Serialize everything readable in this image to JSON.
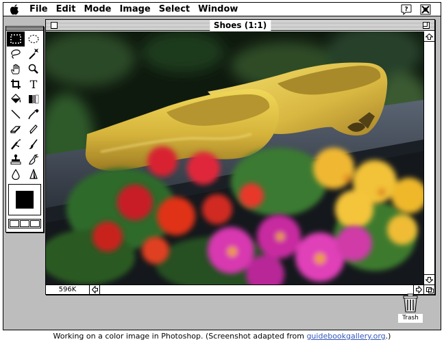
{
  "menubar": {
    "apple_icon": "apple-logo-icon",
    "items": [
      {
        "label": "File"
      },
      {
        "label": "Edit"
      },
      {
        "label": "Mode"
      },
      {
        "label": "Image"
      },
      {
        "label": "Select"
      },
      {
        "label": "Window"
      }
    ],
    "right_icons": [
      "help-balloon-icon",
      "photoshop-app-icon"
    ]
  },
  "tool_palette": {
    "tools": [
      "rectangular-marquee-icon",
      "elliptical-marquee-icon",
      "lasso-icon",
      "magic-wand-icon",
      "hand-icon",
      "zoom-icon",
      "crop-icon",
      "type-icon",
      "paint-bucket-icon",
      "gradient-icon",
      "line-icon",
      "eyedropper-icon",
      "eraser-icon",
      "pencil-icon",
      "airbrush-icon",
      "paintbrush-icon",
      "rubber-stamp-icon",
      "smudge-icon",
      "blur-icon",
      "sharpen-icon"
    ],
    "active_tool": "rectangular-marquee-icon",
    "foreground_color": "#000000"
  },
  "document": {
    "title": "Shoes (1:1)",
    "memory": "596K",
    "image_subject": "yellow-wooden-clogs-with-flowers"
  },
  "desktop": {
    "trash_label": "Trash"
  },
  "caption": {
    "text": "Working on a color image in Photoshop. (Screenshot adapted from ",
    "link": "guidebookgallery.org",
    "suffix": ".)"
  }
}
